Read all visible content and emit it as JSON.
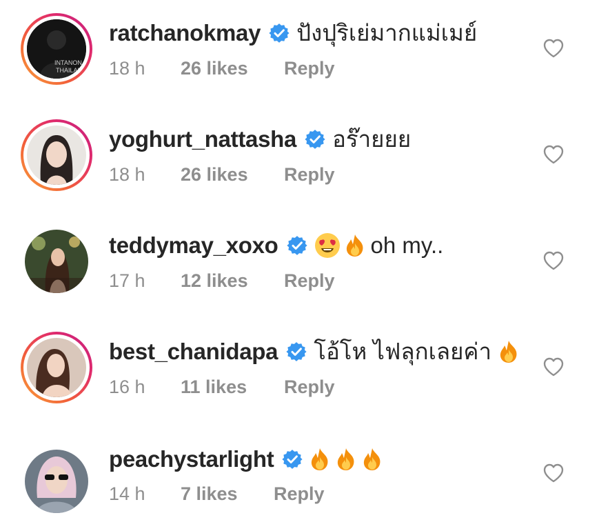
{
  "comments": [
    {
      "username": "ratchanokmay",
      "text": "ปังปุริเย่มากแม่เมย์",
      "time": "18 h",
      "likes": "26 likes",
      "reply": "Reply",
      "avatar_text_1": "INTANON",
      "avatar_text_2": "THAILAND"
    },
    {
      "username": "yoghurt_nattasha",
      "text": "อร๊ายยย",
      "time": "18 h",
      "likes": "26 likes",
      "reply": "Reply"
    },
    {
      "username": "teddymay_xoxo",
      "text": "oh my..",
      "time": "17 h",
      "likes": "12 likes",
      "reply": "Reply"
    },
    {
      "username": "best_chanidapa",
      "text": "โอ้โห ไฟลุกเลยค่า",
      "time": "16 h",
      "likes": "11 likes",
      "reply": "Reply"
    },
    {
      "username": "peachystarlight",
      "text": "",
      "time": "14 h",
      "likes": "7 likes",
      "reply": "Reply"
    }
  ],
  "colors": {
    "verified_blue": "#3897f0",
    "meta_gray": "#8e8e8e",
    "text": "#262626"
  },
  "icons": {
    "verified": "verified-badge-icon",
    "like": "heart-outline-icon",
    "fire": "fire-emoji",
    "heart_eyes": "heart-eyes-emoji"
  }
}
